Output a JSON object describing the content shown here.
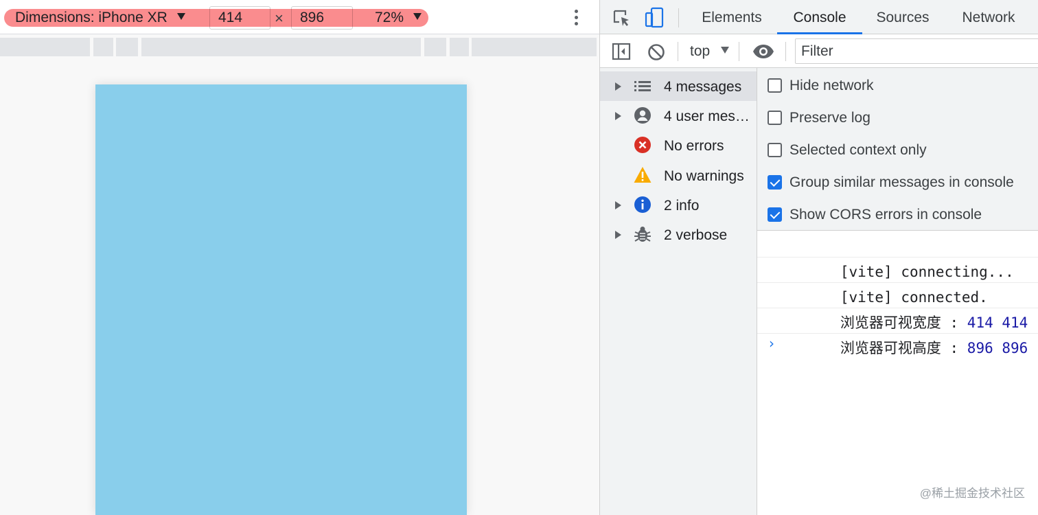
{
  "device_toolbar": {
    "dimensions_label": "Dimensions: iPhone XR",
    "width_value": "414",
    "times_symbol": "×",
    "height_value": "896",
    "zoom_label": "72%"
  },
  "devtools": {
    "tabs": [
      {
        "label": "Elements",
        "active": false
      },
      {
        "label": "Console",
        "active": true
      },
      {
        "label": "Sources",
        "active": false
      },
      {
        "label": "Network",
        "active": false
      }
    ],
    "console_toolbar": {
      "context": "top",
      "filter_placeholder": "Filter"
    },
    "sidebar": {
      "items": [
        {
          "label": "4 messages",
          "icon": "list-icon",
          "expandable": true,
          "selected": true
        },
        {
          "label": "4 user mes…",
          "icon": "user-icon",
          "expandable": true,
          "selected": false
        },
        {
          "label": "No errors",
          "icon": "error-icon",
          "expandable": false,
          "selected": false
        },
        {
          "label": "No warnings",
          "icon": "warning-icon",
          "expandable": false,
          "selected": false
        },
        {
          "label": "2 info",
          "icon": "info-icon",
          "expandable": true,
          "selected": false
        },
        {
          "label": "2 verbose",
          "icon": "bug-icon",
          "expandable": true,
          "selected": false
        }
      ]
    },
    "settings": [
      {
        "label": "Hide network",
        "checked": false
      },
      {
        "label": "Preserve log",
        "checked": false
      },
      {
        "label": "Selected context only",
        "checked": false
      },
      {
        "label": "Group similar messages in console",
        "checked": true
      },
      {
        "label": "Show CORS errors in console",
        "checked": true
      }
    ],
    "messages": [
      {
        "text": "[vite] connecting...",
        "values": ""
      },
      {
        "text": "[vite] connected.",
        "values": ""
      },
      {
        "text": "浏览器可视宽度 : ",
        "values": "414 414"
      },
      {
        "text": "浏览器可视高度 : ",
        "values": "896 896"
      }
    ],
    "prompt_symbol": "›"
  },
  "watermark": "@稀土掘金技术社区",
  "colors": {
    "highlight": "#fa8c8e",
    "viewport": "#89ceeb",
    "accent": "#1a73e8",
    "error": "#d93025",
    "warning": "#f9ab00",
    "info": "#1a5fd4"
  }
}
